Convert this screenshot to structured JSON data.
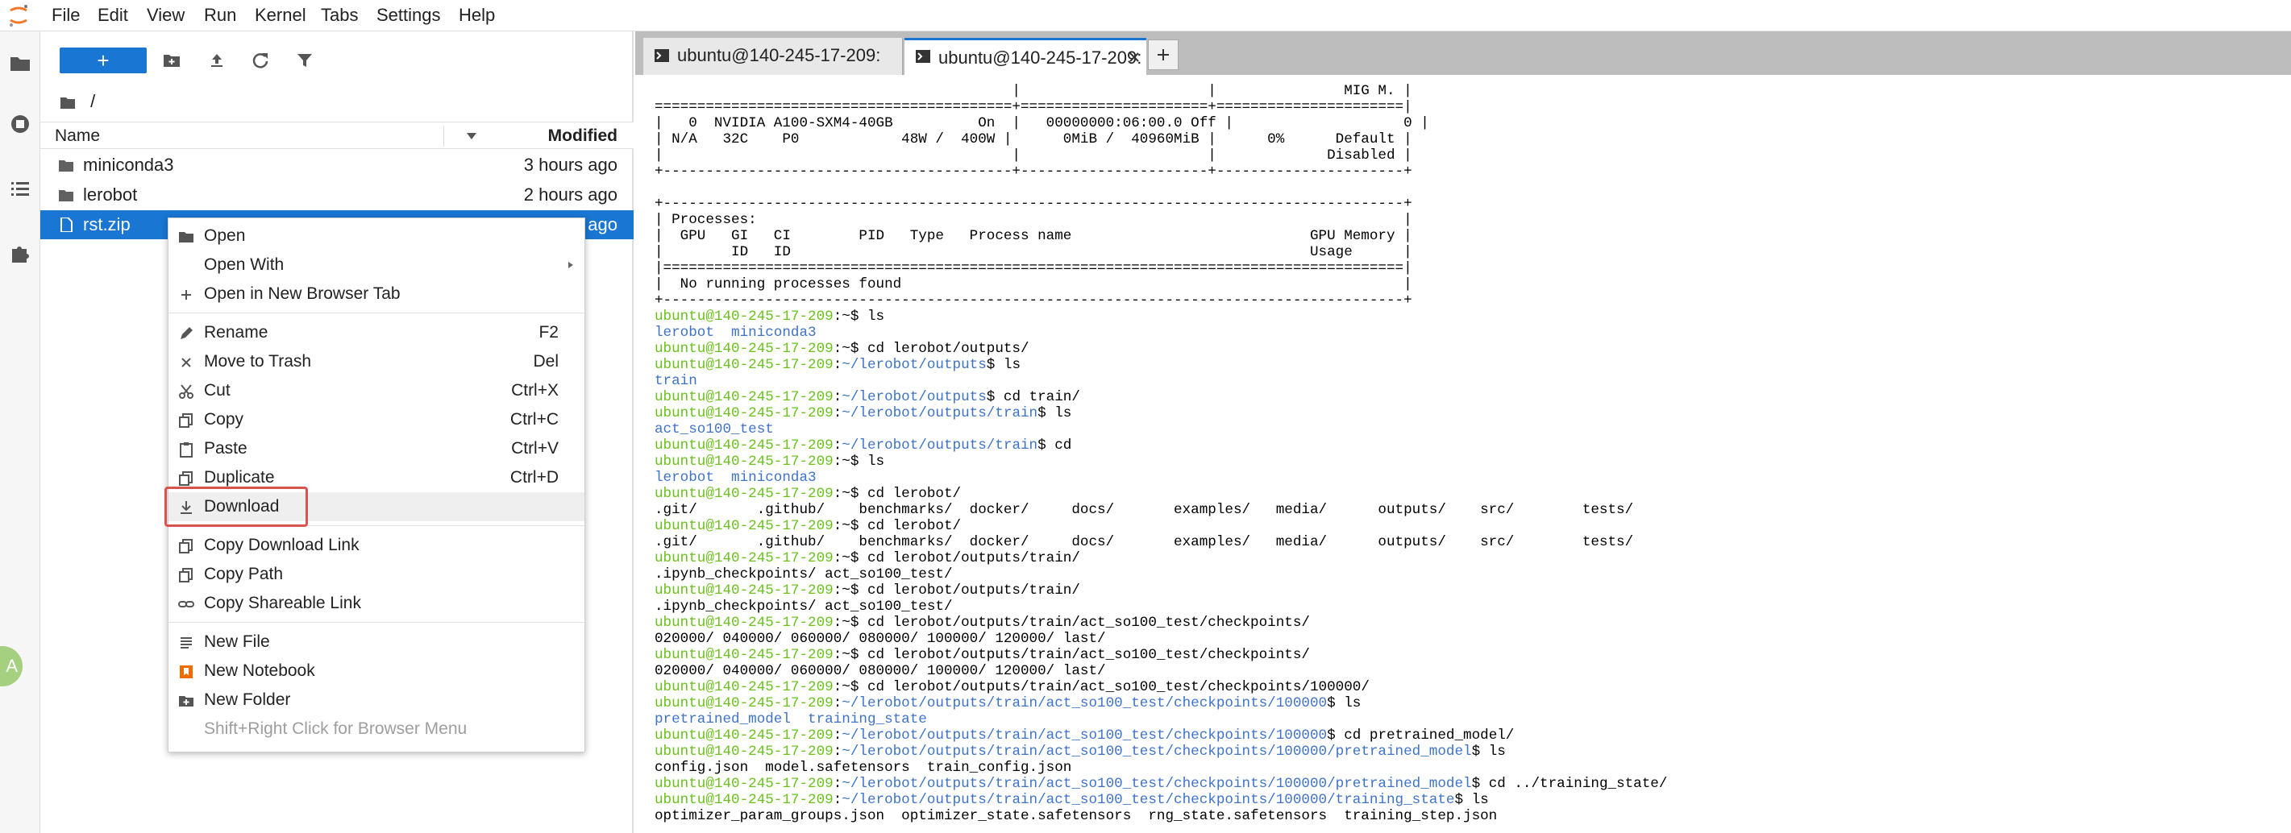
{
  "menubar": {
    "items": [
      "File",
      "Edit",
      "View",
      "Run",
      "Kernel",
      "Tabs",
      "Settings",
      "Help"
    ]
  },
  "filebrowser": {
    "breadcrumb": "/",
    "header": {
      "name": "Name",
      "modified": "Modified"
    },
    "rows": [
      {
        "name": "miniconda3",
        "modified": "3 hours ago",
        "type": "folder"
      },
      {
        "name": "lerobot",
        "modified": "2 hours ago",
        "type": "folder"
      },
      {
        "name": "rst.zip",
        "modified": "ago",
        "type": "file"
      }
    ]
  },
  "tabs": [
    {
      "label": "ubuntu@140-245-17-209:"
    },
    {
      "label": "ubuntu@140-245-17-209:"
    }
  ],
  "context_menu": {
    "open": "Open",
    "open_with": "Open With",
    "open_new_tab": "Open in New Browser Tab",
    "rename": "Rename",
    "rename_sc": "F2",
    "trash": "Move to Trash",
    "trash_sc": "Del",
    "cut": "Cut",
    "cut_sc": "Ctrl+X",
    "copy": "Copy",
    "copy_sc": "Ctrl+C",
    "paste": "Paste",
    "paste_sc": "Ctrl+V",
    "duplicate": "Duplicate",
    "duplicate_sc": "Ctrl+D",
    "download": "Download",
    "copy_download_link": "Copy Download Link",
    "copy_path": "Copy Path",
    "copy_shareable": "Copy Shareable Link",
    "new_file": "New File",
    "new_notebook": "New Notebook",
    "new_folder": "New Folder",
    "browser_menu_hint": "Shift+Right Click for Browser Menu"
  },
  "terminal": {
    "prompt": "ubuntu@140-245-17-209:",
    "lines": [
      [
        [
          "k",
          "                                          |                      |               MIG M. |"
        ]
      ],
      [
        [
          "k",
          "==========================================+======================+======================|"
        ]
      ],
      [
        [
          "k",
          "|   0  NVIDIA A100-SXM4-40GB          On  |   00000000:06:00.0 Off |                    0 |"
        ]
      ],
      [
        [
          "k",
          "| N/A   32C    P0            48W /  400W |      0MiB /  40960MiB |      0%      Default |"
        ]
      ],
      [
        [
          "k",
          "|                                         |                      |             Disabled |"
        ]
      ],
      [
        [
          "k",
          "+-----------------------------------------+----------------------+----------------------+"
        ]
      ],
      [
        [
          "k",
          ""
        ]
      ],
      [
        [
          "k",
          "+---------------------------------------------------------------------------------------+"
        ]
      ],
      [
        [
          "k",
          "| Processes:                                                                            |"
        ]
      ],
      [
        [
          "k",
          "|  GPU   GI   CI        PID   Type   Process name                            GPU Memory |"
        ]
      ],
      [
        [
          "k",
          "|        ID   ID                                                             Usage      |"
        ]
      ],
      [
        [
          "k",
          "|=======================================================================================|"
        ]
      ],
      [
        [
          "k",
          "|  No running processes found                                                           |"
        ]
      ],
      [
        [
          "k",
          "+---------------------------------------------------------------------------------------+"
        ]
      ],
      [
        [
          "g",
          "ubuntu@140-245-17-209"
        ],
        [
          "k",
          ":~$ ls"
        ]
      ],
      [
        [
          "b",
          "lerobot  miniconda3"
        ]
      ],
      [
        [
          "g",
          "ubuntu@140-245-17-209"
        ],
        [
          "k",
          ":~$ cd lerobot/outputs/"
        ]
      ],
      [
        [
          "g",
          "ubuntu@140-245-17-209"
        ],
        [
          "k",
          ":"
        ],
        [
          "b",
          "~/lerobot/outputs"
        ],
        [
          "k",
          "$ ls"
        ]
      ],
      [
        [
          "b",
          "train"
        ]
      ],
      [
        [
          "g",
          "ubuntu@140-245-17-209"
        ],
        [
          "k",
          ":"
        ],
        [
          "b",
          "~/lerobot/outputs"
        ],
        [
          "k",
          "$ cd train/"
        ]
      ],
      [
        [
          "g",
          "ubuntu@140-245-17-209"
        ],
        [
          "k",
          ":"
        ],
        [
          "b",
          "~/lerobot/outputs/train"
        ],
        [
          "k",
          "$ ls"
        ]
      ],
      [
        [
          "b",
          "act_so100_test"
        ]
      ],
      [
        [
          "g",
          "ubuntu@140-245-17-209"
        ],
        [
          "k",
          ":"
        ],
        [
          "b",
          "~/lerobot/outputs/train"
        ],
        [
          "k",
          "$ cd"
        ]
      ],
      [
        [
          "g",
          "ubuntu@140-245-17-209"
        ],
        [
          "k",
          ":~$ ls"
        ]
      ],
      [
        [
          "b",
          "lerobot  miniconda3"
        ]
      ],
      [
        [
          "g",
          "ubuntu@140-245-17-209"
        ],
        [
          "k",
          ":~$ cd lerobot/"
        ]
      ],
      [
        [
          "k",
          ".git/       .github/    benchmarks/  docker/     docs/       examples/   media/      outputs/    src/        tests/"
        ]
      ],
      [
        [
          "g",
          "ubuntu@140-245-17-209"
        ],
        [
          "k",
          ":~$ cd lerobot/"
        ]
      ],
      [
        [
          "k",
          ".git/       .github/    benchmarks/  docker/     docs/       examples/   media/      outputs/    src/        tests/"
        ]
      ],
      [
        [
          "g",
          "ubuntu@140-245-17-209"
        ],
        [
          "k",
          ":~$ cd lerobot/outputs/train/"
        ]
      ],
      [
        [
          "k",
          ".ipynb_checkpoints/ act_so100_test/"
        ]
      ],
      [
        [
          "g",
          "ubuntu@140-245-17-209"
        ],
        [
          "k",
          ":~$ cd lerobot/outputs/train/"
        ]
      ],
      [
        [
          "k",
          ".ipynb_checkpoints/ act_so100_test/"
        ]
      ],
      [
        [
          "g",
          "ubuntu@140-245-17-209"
        ],
        [
          "k",
          ":~$ cd lerobot/outputs/train/act_so100_test/checkpoints/"
        ]
      ],
      [
        [
          "k",
          "020000/ 040000/ 060000/ 080000/ 100000/ 120000/ last/"
        ]
      ],
      [
        [
          "g",
          "ubuntu@140-245-17-209"
        ],
        [
          "k",
          ":~$ cd lerobot/outputs/train/act_so100_test/checkpoints/"
        ]
      ],
      [
        [
          "k",
          "020000/ 040000/ 060000/ 080000/ 100000/ 120000/ last/"
        ]
      ],
      [
        [
          "g",
          "ubuntu@140-245-17-209"
        ],
        [
          "k",
          ":~$ cd lerobot/outputs/train/act_so100_test/checkpoints/100000/"
        ]
      ],
      [
        [
          "g",
          "ubuntu@140-245-17-209"
        ],
        [
          "k",
          ":"
        ],
        [
          "b",
          "~/lerobot/outputs/train/act_so100_test/checkpoints/100000"
        ],
        [
          "k",
          "$ ls"
        ]
      ],
      [
        [
          "b",
          "pretrained_model  training_state"
        ]
      ],
      [
        [
          "g",
          "ubuntu@140-245-17-209"
        ],
        [
          "k",
          ":"
        ],
        [
          "b",
          "~/lerobot/outputs/train/act_so100_test/checkpoints/100000"
        ],
        [
          "k",
          "$ cd pretrained_model/"
        ]
      ],
      [
        [
          "g",
          "ubuntu@140-245-17-209"
        ],
        [
          "k",
          ":"
        ],
        [
          "b",
          "~/lerobot/outputs/train/act_so100_test/checkpoints/100000/pretrained_model"
        ],
        [
          "k",
          "$ ls"
        ]
      ],
      [
        [
          "k",
          "config.json  model.safetensors  train_config.json"
        ]
      ],
      [
        [
          "g",
          "ubuntu@140-245-17-209"
        ],
        [
          "k",
          ":"
        ],
        [
          "b",
          "~/lerobot/outputs/train/act_so100_test/checkpoints/100000/pretrained_model"
        ],
        [
          "k",
          "$ cd ../training_state/"
        ]
      ],
      [
        [
          "g",
          "ubuntu@140-245-17-209"
        ],
        [
          "k",
          ":"
        ],
        [
          "b",
          "~/lerobot/outputs/train/act_so100_test/checkpoints/100000/training_state"
        ],
        [
          "k",
          "$ ls"
        ]
      ],
      [
        [
          "k",
          "optimizer_param_groups.json  optimizer_state.safetensors  rng_state.safetensors  training_step.json"
        ]
      ]
    ]
  },
  "avatar": {
    "text": "A"
  },
  "colors": {
    "accent": "#1976d2",
    "highlight_box": "#d9534f",
    "prompt_green": "#6bc21d",
    "path_blue": "#3f73c9"
  }
}
